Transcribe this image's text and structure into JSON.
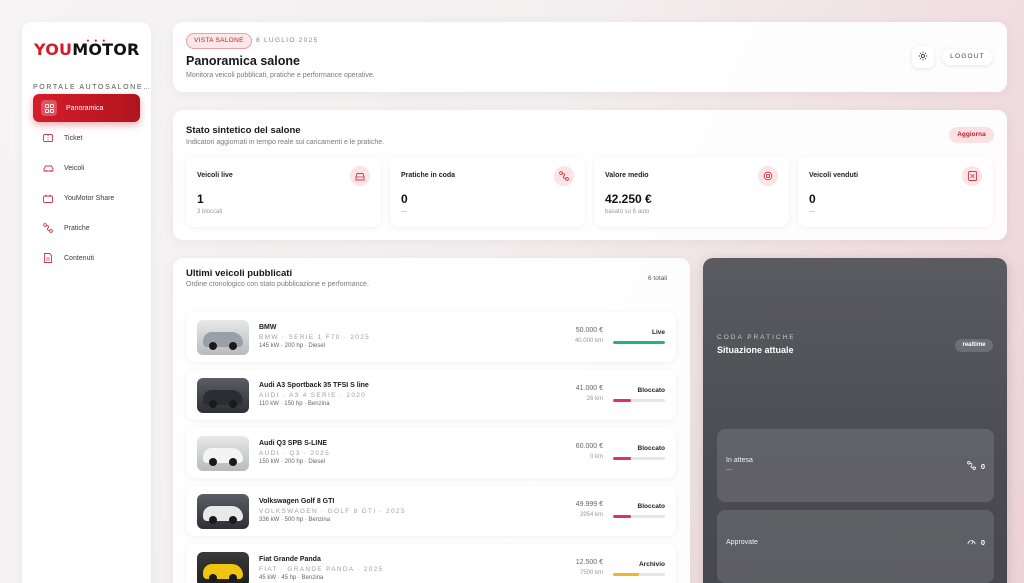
{
  "brand": {
    "logo_you": "YOU",
    "logo_motor": "MOTOR",
    "subtitle": "PORTALE AUTOSALONE…"
  },
  "sidebar": {
    "items": [
      {
        "label": "Panoramica",
        "icon": "dashboard-icon",
        "active": true
      },
      {
        "label": "Ticket",
        "icon": "ticket-icon",
        "active": false
      },
      {
        "label": "Veicoli",
        "icon": "car-icon",
        "active": false
      },
      {
        "label": "YouMotor Share",
        "icon": "share-icon",
        "active": false
      },
      {
        "label": "Pratiche",
        "icon": "route-icon",
        "active": false
      },
      {
        "label": "Contenuti",
        "icon": "document-icon",
        "active": false
      }
    ]
  },
  "header": {
    "badge": "VISTA SALONE",
    "date": "8 LUGLIO 2025",
    "title": "Panoramica salone",
    "subtitle": "Monitora veicoli pubblicati, pratiche e performance operative.",
    "settings_icon": "gear-icon",
    "logout_label": "LOGOUT"
  },
  "summary": {
    "title": "Stato sintetico del salone",
    "subtitle": "Indicatori aggiornati in tempo reale sui caricamenti e le pratiche.",
    "refresh_label": "Aggiorna",
    "stats": [
      {
        "label": "Veicoli live",
        "value": "1",
        "note": "3 bloccati",
        "icon": "car-front-icon"
      },
      {
        "label": "Pratiche in coda",
        "value": "0",
        "note": "—",
        "icon": "route-icon"
      },
      {
        "label": "Valore medio",
        "value": "42.250 €",
        "note": "basato su 6 auto",
        "icon": "target-icon"
      },
      {
        "label": "Veicoli venduti",
        "value": "0",
        "note": "—",
        "icon": "receipt-icon"
      }
    ]
  },
  "vehicles": {
    "title": "Ultimi veicoli pubblicati",
    "subtitle": "Ordine cronologico con stato pubblicazione e performance.",
    "total": "6 totali",
    "rows": [
      {
        "name": "BMW",
        "meta": "BMW · SERIE 1 F70 · 2025",
        "spec": "145 kW · 200 hp · Diesel",
        "price": "50.000 €",
        "km": "40.000 km",
        "status": "Live",
        "progress": 1.0,
        "bar_color": "#22b573",
        "thumb": "light",
        "car_color": "#9aa0a8"
      },
      {
        "name": "Audi A3 Sportback 35 TFSI S line",
        "meta": "AUDI · A3 4 SERIE · 2020",
        "spec": "110 kW · 150 hp · Benzina",
        "price": "41.000 €",
        "km": "26 km",
        "status": "Bloccato",
        "progress": 0.35,
        "bar_color": "#e0325a",
        "thumb": "dark",
        "car_color": "#2b2d33"
      },
      {
        "name": "Audi Q3 SPB S-LINE",
        "meta": "AUDI · Q3 · 2025",
        "spec": "150 kW · 200 hp · Diesel",
        "price": "60.000 €",
        "km": "0 km",
        "status": "Bloccato",
        "progress": 0.35,
        "bar_color": "#e0325a",
        "thumb": "light",
        "car_color": "#f4f4f4"
      },
      {
        "name": "Volkswagen Golf 8 GTI",
        "meta": "VOLKSWAGEN · GOLF 8 GTI · 2025",
        "spec": "336 kW · 500 hp · Benzina",
        "price": "49.999 €",
        "km": "3954 km",
        "status": "Bloccato",
        "progress": 0.35,
        "bar_color": "#e0325a",
        "thumb": "dark",
        "car_color": "#e9e9ea"
      },
      {
        "name": "Fiat Grande Panda",
        "meta": "FIAT · GRANDE PANDA · 2025",
        "spec": "45 kW · 45 hp · Benzina",
        "price": "12.500 €",
        "km": "7500 km",
        "status": "Archivio",
        "progress": 0.5,
        "bar_color": "#f0b429",
        "thumb": "yellow",
        "car_color": "#f1c40f"
      }
    ]
  },
  "queue": {
    "eyebrow": "CODA PRATICHE",
    "title": "Situazione attuale",
    "badge": "realtime",
    "rows": [
      {
        "label": "In attesa",
        "sub": "—",
        "value": "0",
        "icon": "route-icon"
      },
      {
        "label": "Approvate",
        "sub": "",
        "value": "0",
        "icon": "gauge-icon"
      }
    ]
  }
}
